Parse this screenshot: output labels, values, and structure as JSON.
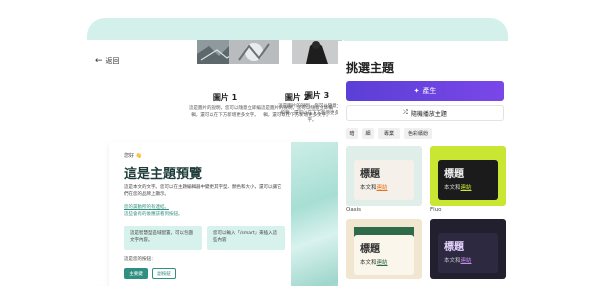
{
  "left": {
    "back_label": "返回",
    "cards": [
      {
        "title": "圖片 1",
        "desc": "這是圖片的說明，您可以隨意立即編輯，還可以在下方新增更多文字。"
      },
      {
        "title": "圖片 2",
        "desc": "這是圖片的說明，您可以隨意立即編輯，還可以在下方新增更多文字。"
      },
      {
        "title": "圖片 3",
        "desc": "這是圖片的說明，您可以隨意立即編輯，還可以在下方新增更多文字。"
      }
    ]
  },
  "preview": {
    "tag": "您好 👋",
    "title": "這是主題預覽",
    "body": "這是本文的文字。您可以在主題編輯器中變更其字型、顏色和大小，還可以讓它們在您的品牌上顯示。",
    "link1": "您的黨動所的有連結。",
    "link2": "這些會有的後應該看到按鈕。",
    "callout1": "這是智慧型區域配置，可以包圍文字內容。",
    "callout2": "您可以輸入「/smart」來插入這些內容",
    "ask": "這是您的按鈕：",
    "primary_btn": "主要鍵",
    "secondary_btn": "副按鈕"
  },
  "right": {
    "title": "挑選主題",
    "generate": "產生",
    "shuffle": "隨機播放主題",
    "filters": [
      "暗",
      "細",
      "專業",
      "色彩繽紛"
    ],
    "themes": [
      {
        "name": "Oasis",
        "title": "標題",
        "body": "本文和",
        "link": "連結",
        "accent": "#e8731c"
      },
      {
        "name": "Fluo",
        "title": "標題",
        "body": "本文和",
        "link": "連結",
        "accent": "#c9e632"
      },
      {
        "name": "",
        "title": "標題",
        "body": "本文和",
        "link": "連結",
        "accent": "#2d6b4a"
      },
      {
        "name": "",
        "title": "標題",
        "body": "本文和",
        "link": "連結",
        "accent": "#c58be8"
      }
    ]
  }
}
